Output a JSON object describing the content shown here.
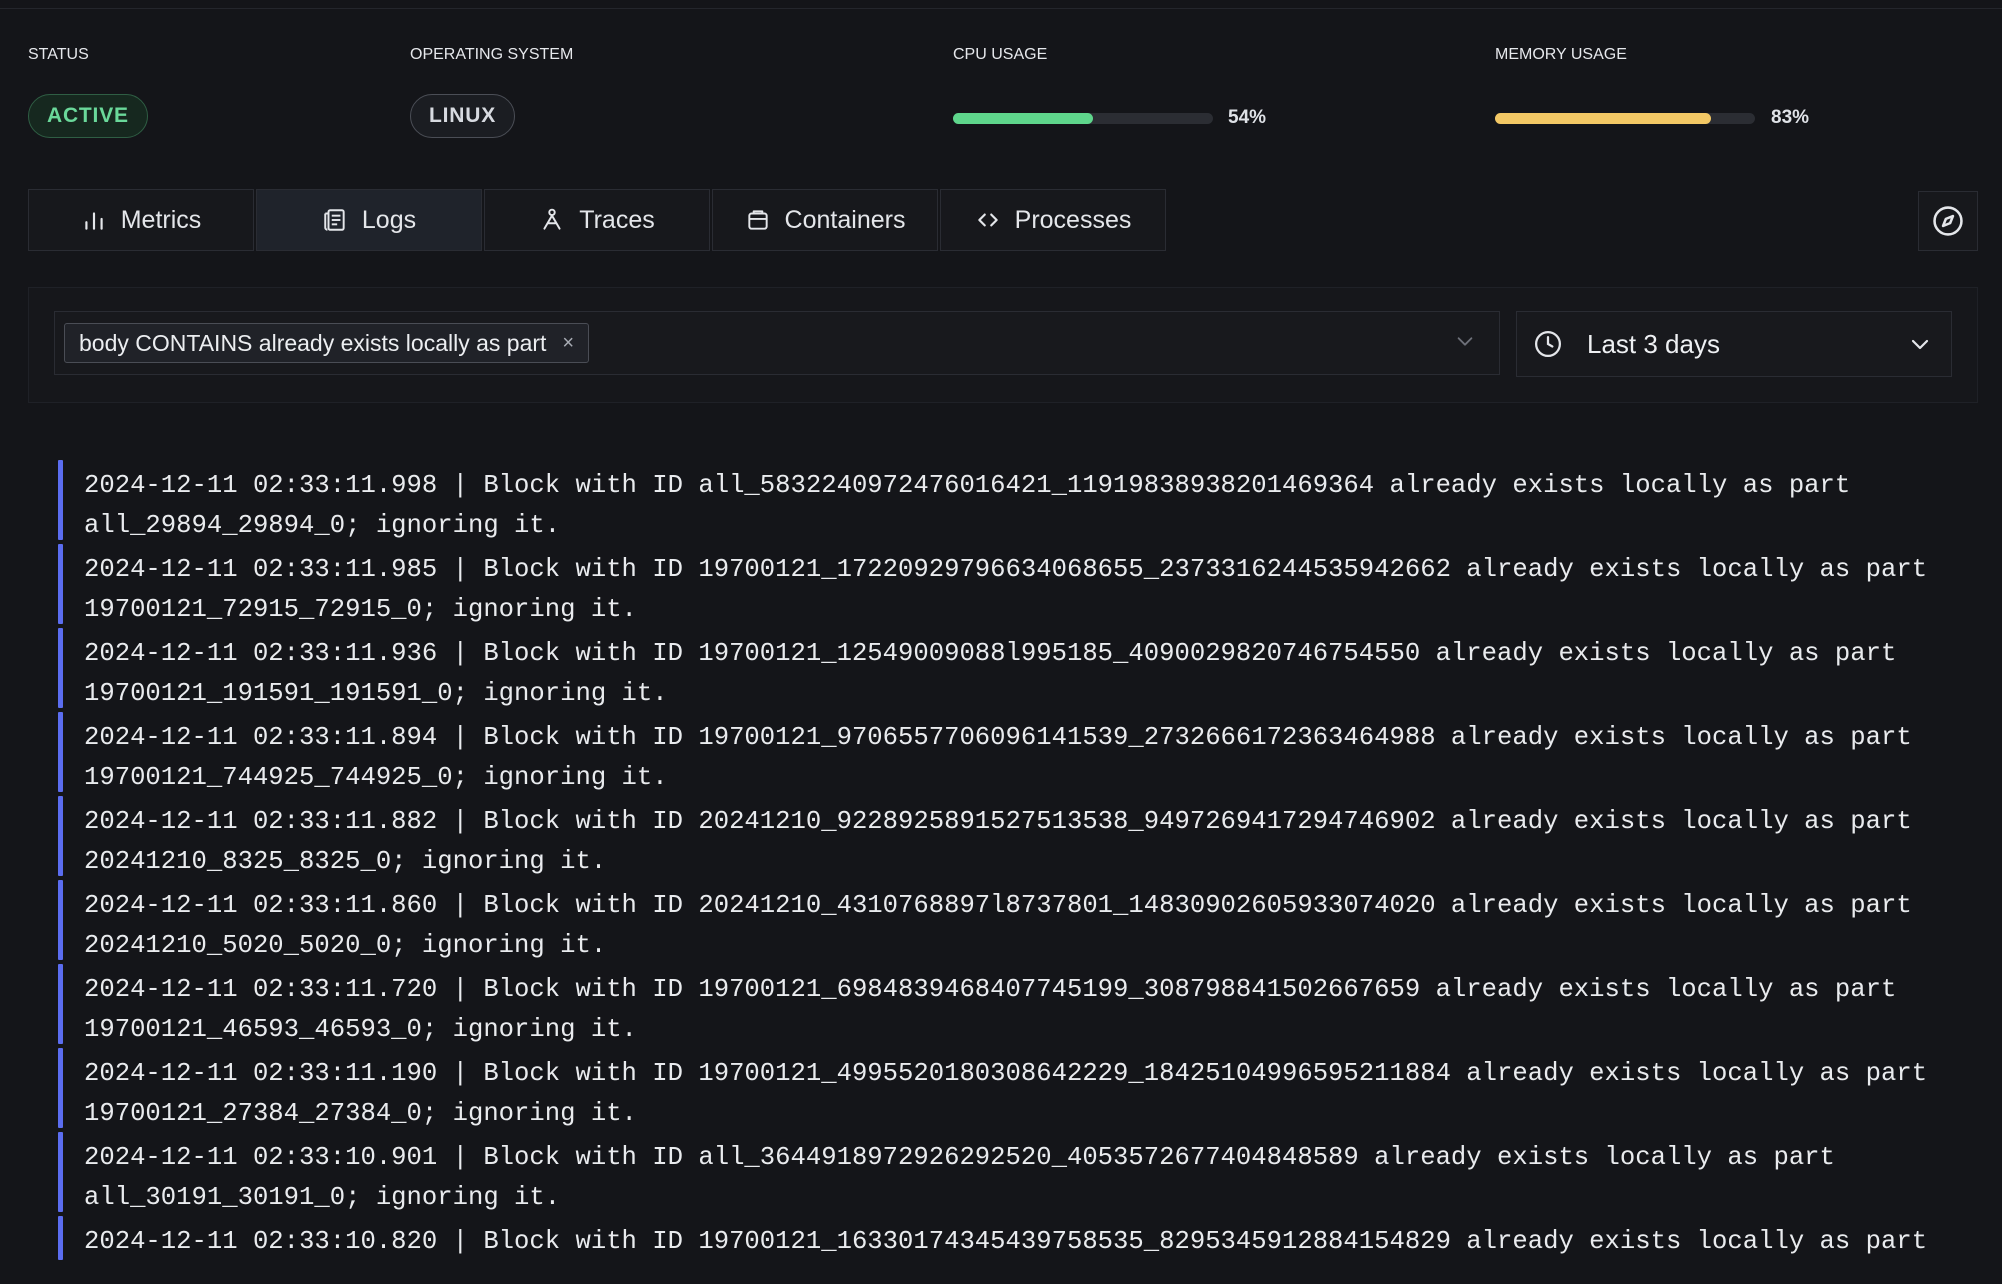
{
  "status": {
    "status_label": "STATUS",
    "status_value": "ACTIVE",
    "os_label": "OPERATING SYSTEM",
    "os_value": "LINUX",
    "cpu_label": "CPU USAGE",
    "cpu_value": "54%",
    "cpu_fraction": 0.54,
    "cpu_color": "#5fd68c",
    "mem_label": "MEMORY USAGE",
    "mem_value": "83%",
    "mem_fraction": 0.83,
    "mem_color": "#f3c865"
  },
  "tabs": [
    {
      "label": "Metrics",
      "icon": "bar-chart-icon"
    },
    {
      "label": "Logs",
      "icon": "logs-icon"
    },
    {
      "label": "Traces",
      "icon": "traces-icon"
    },
    {
      "label": "Containers",
      "icon": "container-icon"
    },
    {
      "label": "Processes",
      "icon": "code-icon"
    }
  ],
  "active_tab": "Logs",
  "filter": {
    "chip_text": "body CONTAINS already exists locally as part",
    "chip_remove": "×",
    "time_range": "Last 3 days"
  },
  "logs": [
    "2024-12-11 02:33:11.998 | Block with ID all_5832240972476016421_11919838938201469364 already exists locally as part all_29894_29894_0; ignoring it.",
    "2024-12-11 02:33:11.985 | Block with ID 19700121_17220929796634068655_2373316244535942662 already exists locally as part 19700121_72915_72915_0; ignoring it.",
    "2024-12-11 02:33:11.936 | Block with ID 19700121_12549009088l995185_4090029820746754550 already exists locally as part 19700121_191591_191591_0; ignoring it.",
    "2024-12-11 02:33:11.894 | Block with ID 19700121_9706557706096141539_2732666172363464988 already exists locally as part 19700121_744925_744925_0; ignoring it.",
    "2024-12-11 02:33:11.882 | Block with ID 20241210_9228925891527513538_9497269417294746902 already exists locally as part 20241210_8325_8325_0; ignoring it.",
    "2024-12-11 02:33:11.860 | Block with ID 20241210_4310768897l8737801_14830902605933074020 already exists locally as part 20241210_5020_5020_0; ignoring it.",
    "2024-12-11 02:33:11.720 | Block with ID 19700121_6984839468407745199_308798841502667659 already exists locally as part 19700121_46593_46593_0; ignoring it.",
    "2024-12-11 02:33:11.190 | Block with ID 19700121_4995520180308642229_18425104996595211884 already exists locally as part 19700121_27384_27384_0; ignoring it.",
    "2024-12-11 02:33:10.901 | Block with ID all_3644918972926292520_4053572677404848589 already exists locally as part all_30191_30191_0; ignoring it.",
    "2024-12-11 02:33:10.820 | Block with ID 19700121_16330174345439758535_8295345912884154829 already exists locally as part"
  ]
}
